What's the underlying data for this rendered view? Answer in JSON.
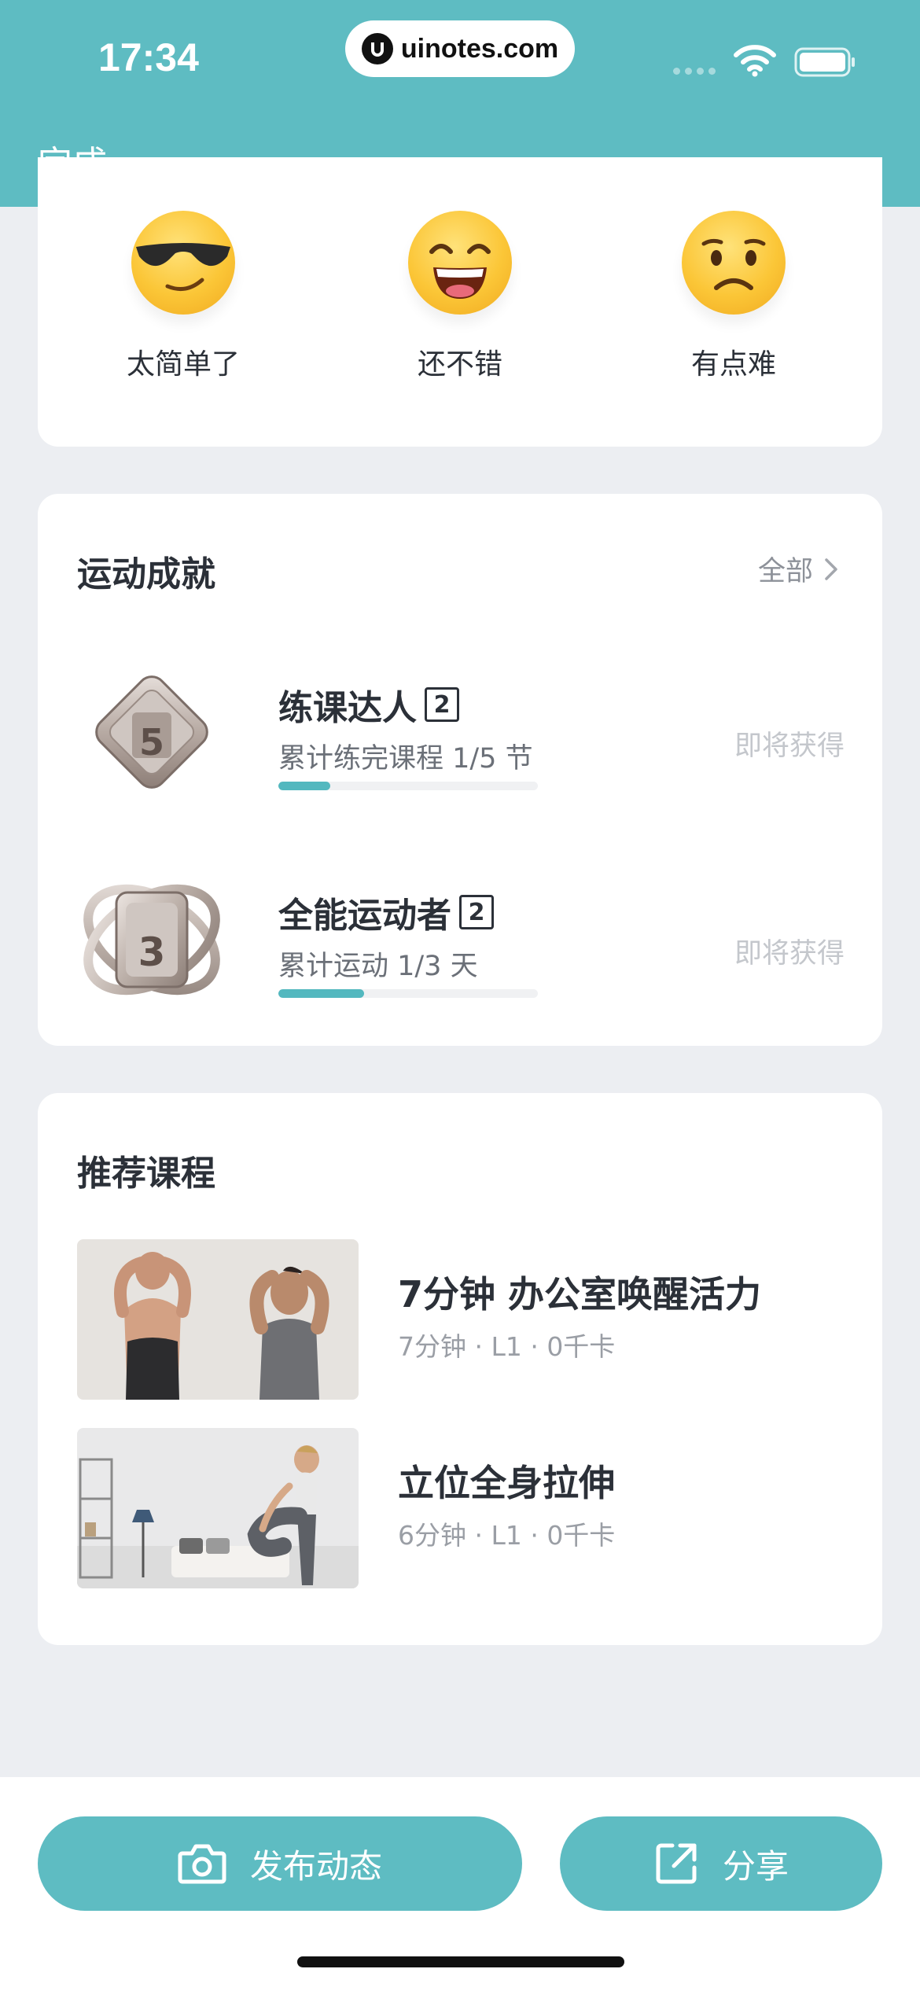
{
  "status_bar": {
    "time": "17:34",
    "url": "uinotes.com"
  },
  "header": {
    "done_label": "完成"
  },
  "rating": {
    "options": [
      {
        "label": "太简单了",
        "icon": "cool-sunglasses-emoji-icon"
      },
      {
        "label": "还不错",
        "icon": "grinning-emoji-icon"
      },
      {
        "label": "有点难",
        "icon": "frowning-emoji-icon"
      }
    ]
  },
  "achievements": {
    "title": "运动成就",
    "see_all_label": "全部",
    "items": [
      {
        "name": "练课达人",
        "level": "2",
        "desc": "累计练完课程  1/5  节",
        "progress": 0.2,
        "status": "即将获得",
        "badge_number": "5"
      },
      {
        "name": "全能运动者",
        "level": "2",
        "desc": "累计运动  1/3  天",
        "progress": 0.33,
        "status": "即将获得",
        "badge_number": "3"
      }
    ]
  },
  "recommended": {
    "title": "推荐课程",
    "courses": [
      {
        "title": "7分钟 办公室唤醒活力",
        "meta": "7分钟 · L1 · 0千卡"
      },
      {
        "title": "立位全身拉伸",
        "meta": "6分钟 · L1 · 0千卡"
      }
    ]
  },
  "bottom": {
    "post_label": "发布动态",
    "share_label": "分享"
  },
  "colors": {
    "accent": "#5ebcc2",
    "progress": "#53b8bf",
    "background": "#eceef2"
  }
}
